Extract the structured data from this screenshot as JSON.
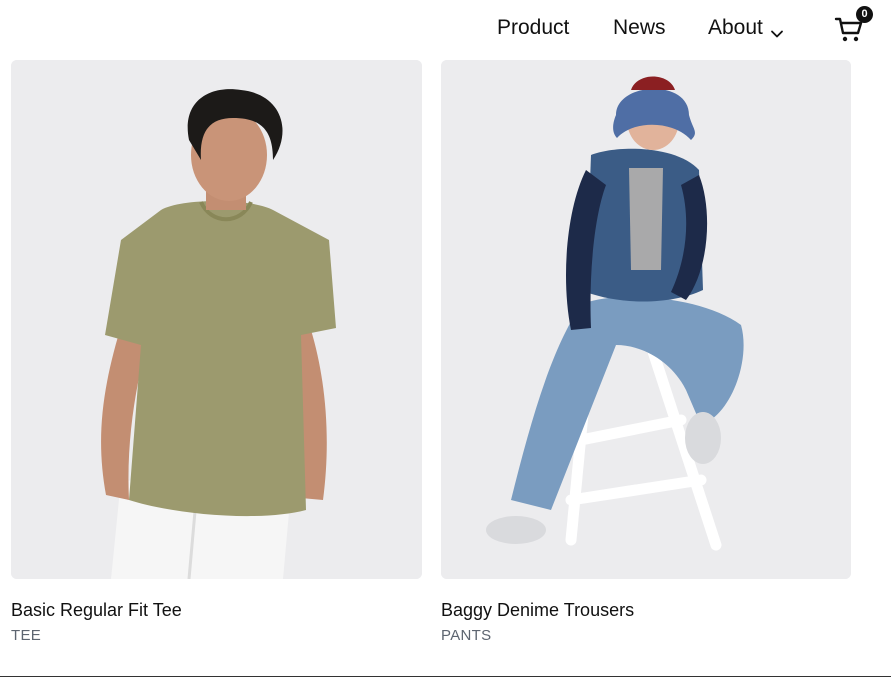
{
  "nav": {
    "items": [
      {
        "label": "Product"
      },
      {
        "label": "News"
      },
      {
        "label": "About",
        "has_dropdown": true,
        "icon": "chevron-down-icon"
      }
    ],
    "cart": {
      "icon": "cart-icon",
      "count": "0"
    }
  },
  "products": [
    {
      "title": "Basic Regular Fit Tee",
      "category": "TEE",
      "image": "model-olive-tee-white-jeans"
    },
    {
      "title": "Baggy Denime Trousers",
      "category": "PANTS",
      "image": "model-denim-vest-bucket-hat-on-stool"
    }
  ],
  "colors": {
    "text": "#111111",
    "category": "#5d6570",
    "photo_background": "#ececee"
  }
}
